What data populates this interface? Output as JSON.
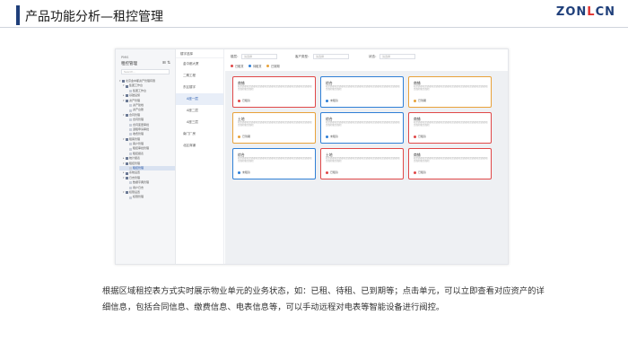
{
  "slide": {
    "title": "产品功能分析—租控管理",
    "logo_main": "ZON",
    "logo_mark": "L",
    "logo_end": "CN"
  },
  "colors": {
    "accent": "#1f3f7a",
    "rented": "#e04848",
    "pending": "#2f7fd6",
    "expired": "#e8a23a"
  },
  "sidebar": {
    "app_name": "PMIS",
    "title": "租控管理",
    "tools": "⊞ ⇅",
    "search_placeholder": "Search...",
    "tree": [
      {
        "label": "北京金中都资产管理有限",
        "toggle": "▾",
        "icon": "folder",
        "active": false
      },
      {
        "label": "集团工作台",
        "toggle": "▾",
        "icon": "folder",
        "active": false
      },
      {
        "label": "集团工作台",
        "toggle": "",
        "icon": "page",
        "active": false
      },
      {
        "label": "基础设施",
        "toggle": "▸",
        "icon": "folder",
        "active": false
      },
      {
        "label": "资产管理",
        "toggle": "▾",
        "icon": "folder",
        "active": false
      },
      {
        "label": "资产建档",
        "toggle": "",
        "icon": "page",
        "active": false
      },
      {
        "label": "资产台账",
        "toggle": "",
        "icon": "page",
        "active": false
      },
      {
        "label": "合同管理",
        "toggle": "▾",
        "icon": "folder",
        "active": false
      },
      {
        "label": "合同管理",
        "toggle": "",
        "icon": "page",
        "active": false
      },
      {
        "label": "合同变更审批",
        "toggle": "",
        "icon": "page",
        "active": false
      },
      {
        "label": "退租申请审批",
        "toggle": "",
        "icon": "page",
        "active": false
      },
      {
        "label": "收费管理",
        "toggle": "",
        "icon": "page",
        "active": false
      },
      {
        "label": "租客管理",
        "toggle": "▾",
        "icon": "folder",
        "active": false
      },
      {
        "label": "客户管理",
        "toggle": "",
        "icon": "page",
        "active": false
      },
      {
        "label": "租控审批管理",
        "toggle": "",
        "icon": "page",
        "active": false
      },
      {
        "label": "租控报表",
        "toggle": "",
        "icon": "page",
        "active": false
      },
      {
        "label": "统计报表",
        "toggle": "▸",
        "icon": "folder",
        "active": false
      },
      {
        "label": "租控管理",
        "toggle": "▾",
        "icon": "folder",
        "active": false
      },
      {
        "label": "租控管理",
        "toggle": "",
        "icon": "page",
        "active": true
      },
      {
        "label": "系统设置",
        "toggle": "▸",
        "icon": "folder",
        "active": false
      },
      {
        "label": "日志管理",
        "toggle": "▾",
        "icon": "folder",
        "active": false
      },
      {
        "label": "数据字典管理",
        "toggle": "",
        "icon": "page",
        "active": false
      },
      {
        "label": "用户日志",
        "toggle": "",
        "icon": "page",
        "active": false
      },
      {
        "label": "权限设置",
        "toggle": "▾",
        "icon": "folder",
        "active": false
      },
      {
        "label": "权限管理",
        "toggle": "",
        "icon": "page",
        "active": false
      }
    ]
  },
  "col2": {
    "header": "楼宇选择",
    "items": [
      {
        "label": "金中都大厦",
        "active": false,
        "sub": false
      },
      {
        "label": "二期工程",
        "active": false,
        "sub": false
      },
      {
        "label": "东区楼宇",
        "active": false,
        "sub": false
      },
      {
        "label": "A座一层",
        "active": true,
        "sub": true
      },
      {
        "label": "A座二层",
        "active": false,
        "sub": true
      },
      {
        "label": "A座三层",
        "active": false,
        "sub": true
      },
      {
        "label": "南门厂房",
        "active": false,
        "sub": false
      },
      {
        "label": "北区商铺",
        "active": false,
        "sub": false
      }
    ]
  },
  "filters": {
    "f1_label": "楼层：",
    "f1_placeholder": "请选择",
    "f2_label": "客户类型：",
    "f2_placeholder": "请选择",
    "f3_label": "状态：",
    "f3_placeholder": "请选择"
  },
  "legend": [
    {
      "label": "已租赁",
      "color": "#e04848"
    },
    {
      "label": "待租赁",
      "color": "#2f7fd6"
    },
    {
      "label": "已到期",
      "color": "#e8a23a"
    }
  ],
  "cards": [
    {
      "title": "商铺",
      "desc": "租赁面积租赁面积租赁面积租赁面积租赁面积租赁面积租赁面积租赁面积租赁面积租赁面积",
      "status": "已租赁",
      "color": "#e04848"
    },
    {
      "title": "综合",
      "desc": "租赁面积租赁面积租赁面积租赁面积租赁面积租赁面积租赁面积租赁面积租赁面积租赁面积",
      "status": "未租赁",
      "color": "#2f7fd6"
    },
    {
      "title": "商铺",
      "desc": "租赁面积租赁面积租赁面积租赁面积租赁面积租赁面积租赁面积租赁面积租赁面积租赁面积",
      "status": "已到期",
      "color": "#e8a23a"
    },
    {
      "title": "土地",
      "desc": "租赁面积租赁面积租赁面积租赁面积租赁面积租赁面积租赁面积租赁面积租赁面积租赁面积",
      "status": "已到期",
      "color": "#e8a23a"
    },
    {
      "title": "综合",
      "desc": "租赁面积租赁面积租赁面积租赁面积租赁面积租赁面积租赁面积租赁面积租赁面积租赁面积",
      "status": "未租赁",
      "color": "#2f7fd6"
    },
    {
      "title": "商铺",
      "desc": "租赁面积租赁面积租赁面积租赁面积租赁面积租赁面积租赁面积租赁面积租赁面积租赁面积",
      "status": "已租赁",
      "color": "#e04848"
    },
    {
      "title": "综合",
      "desc": "租赁面积租赁面积租赁面积租赁面积租赁面积租赁面积租赁面积租赁面积租赁面积租赁面积",
      "status": "未租赁",
      "color": "#2f7fd6"
    },
    {
      "title": "土地",
      "desc": "租赁面积租赁面积租赁面积租赁面积租赁面积租赁面积租赁面积租赁面积租赁面积租赁面积",
      "status": "已租赁",
      "color": "#e04848"
    },
    {
      "title": "商铺",
      "desc": "租赁面积租赁面积租赁面积租赁面积租赁面积租赁面积租赁面积租赁面积租赁面积租赁面积",
      "status": "已租赁",
      "color": "#e04848"
    }
  ],
  "caption": "根据区域租控表方式实时展示物业单元的业务状态，如：已租、待租、已到期等；点击单元，可以立即查看对应资产的详细信息，包括合同信息、缴费信息、电表信息等，可以手动远程对电表等智能设备进行阀控。"
}
